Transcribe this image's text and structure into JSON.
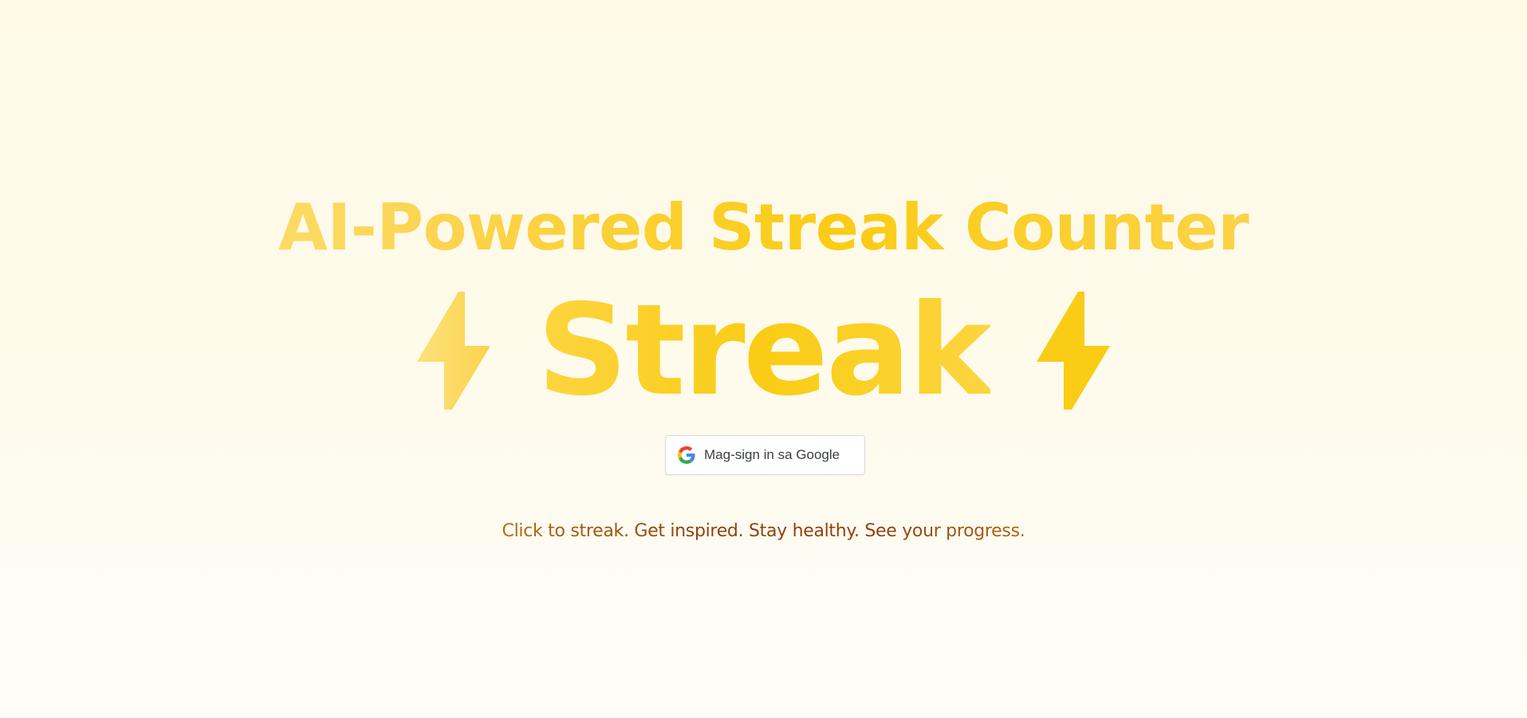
{
  "hero": {
    "headline": "AI-Powered Streak Counter",
    "wordmark": "Streak",
    "left_icon": "lightning-bolt-icon",
    "right_icon": "lightning-bolt-icon",
    "tagline": "Click to streak. Get inspired. Stay healthy. See your progress."
  },
  "auth": {
    "google_button_label": "Mag-sign in sa Google",
    "google_icon": "google-g-logo-icon"
  },
  "colors": {
    "background": "#fefae6",
    "accent_yellow": "#facc15",
    "light_yellow": "#fde68a",
    "tagline_dark": "#92400e",
    "tagline_light": "#e0a82e",
    "button_border": "#d7d9de",
    "button_text": "#3c4043"
  }
}
